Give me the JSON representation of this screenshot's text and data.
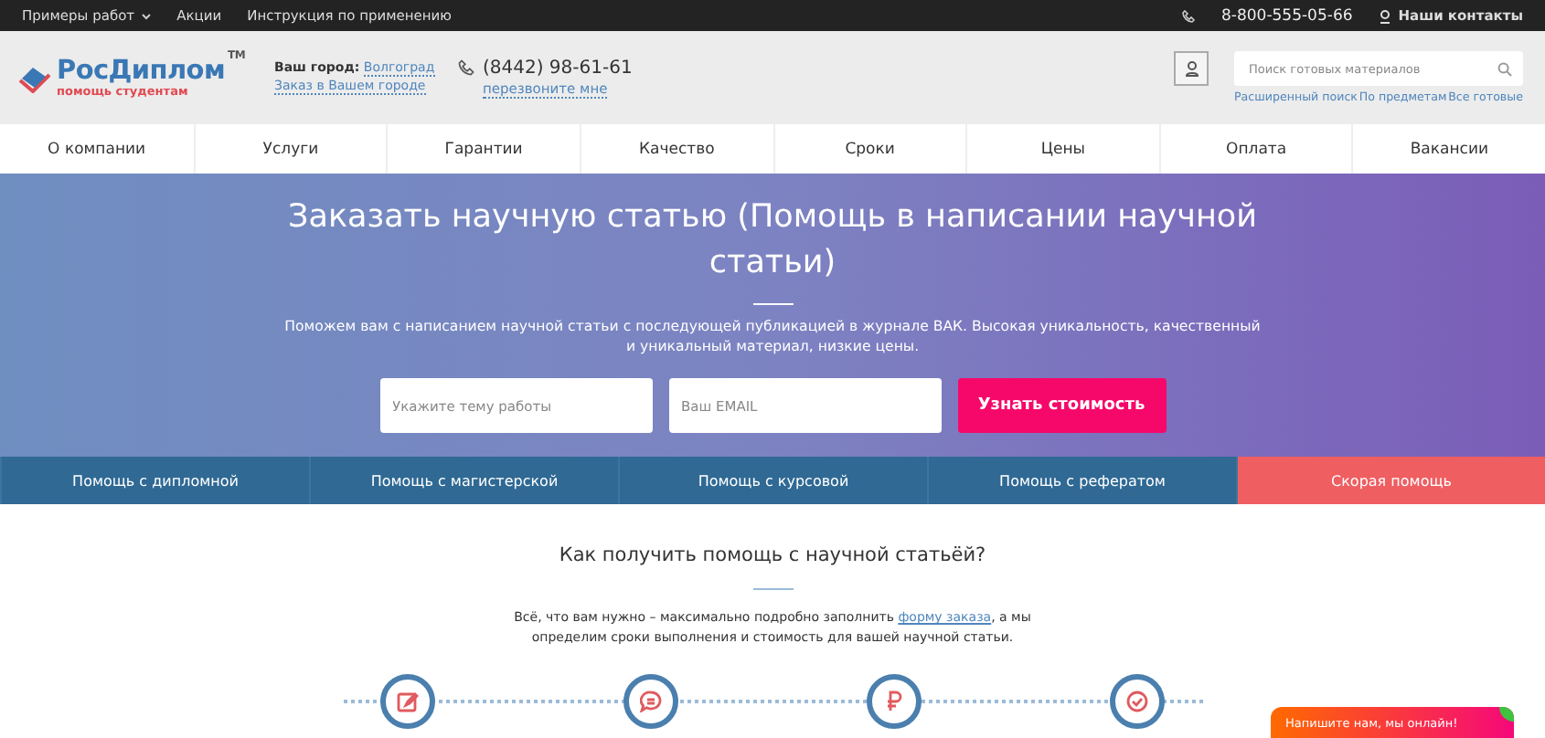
{
  "top_bar": {
    "links": [
      {
        "label": "Примеры работ",
        "dropdown": true
      },
      {
        "label": "Акции",
        "dropdown": false
      },
      {
        "label": "Инструкция по применению",
        "dropdown": false
      }
    ],
    "phone": "8-800-555-05-66",
    "contacts": "Наши контакты"
  },
  "header": {
    "logo": {
      "name": "РосДиплом",
      "tm": "TM",
      "tagline": "помощь студентам"
    },
    "city_label": "Ваш город:",
    "city": "Волгоград",
    "city_order": "Заказ в Вашем городе",
    "phone": "(8442) 98-61-61",
    "callback": "перезвоните мне",
    "search": {
      "placeholder": "Поиск готовых материалов"
    },
    "search_links": [
      "Расширенный поиск",
      "По предметам",
      "Все готовые"
    ]
  },
  "nav": [
    "О компании",
    "Услуги",
    "Гарантии",
    "Качество",
    "Сроки",
    "Цены",
    "Оплата",
    "Вакансии"
  ],
  "hero": {
    "title": "Заказать научную статью (Помощь в написании научной статьи)",
    "subtitle": "Поможем вам с написанием научной статьи с последующей публикацией в журнале ВАК. Высокая уникальность, качественный и уникальный материал, низкие цены.",
    "topic": {
      "placeholder": "Укажите тему работы"
    },
    "email": {
      "placeholder": "Ваш EMAIL"
    },
    "button": "Узнать стоимость"
  },
  "services": [
    {
      "label": "Помощь с дипломной",
      "kind": "normal"
    },
    {
      "label": "Помощь с магистерской",
      "kind": "normal"
    },
    {
      "label": "Помощь с курсовой",
      "kind": "normal"
    },
    {
      "label": "Помощь с рефератом",
      "kind": "normal"
    },
    {
      "label": "Скорая помощь",
      "kind": "urgent"
    }
  ],
  "how_to": {
    "title": "Как получить помощь с научной статьёй?",
    "text_before": "Всё, что вам нужно – максимально подробно заполнить",
    "link": "форму заказа",
    "text_after": ", а мы определим сроки выполнения и стоимость для вашей научной статьи.",
    "steps": [
      {
        "kind": "edit"
      },
      {
        "kind": "chat"
      },
      {
        "kind": "ruble"
      },
      {
        "kind": "check"
      }
    ]
  },
  "chat": {
    "label": "Напишите нам, мы онлайн!"
  }
}
